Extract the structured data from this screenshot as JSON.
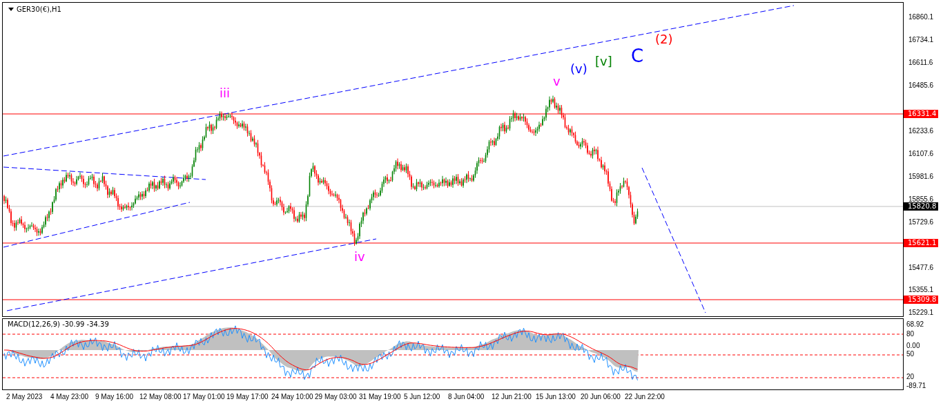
{
  "chart": {
    "title": "GER30(€),H1"
  },
  "wave_labels": [
    {
      "text": "iii",
      "color": "#ff00ff"
    },
    {
      "text": "iv",
      "color": "#ff00ff"
    },
    {
      "text": "v",
      "color": "#ff00ff"
    },
    {
      "text": "(v)",
      "color": "#0000ff"
    },
    {
      "text": "[v]",
      "color": "#008000"
    },
    {
      "text": "C",
      "color": "#0000ff"
    },
    {
      "text": "(2)",
      "color": "#ff0000"
    }
  ],
  "price_axis": [
    {
      "kind": "tick",
      "text": "16860.1"
    },
    {
      "kind": "tick",
      "text": "16734.1"
    },
    {
      "kind": "tick",
      "text": "16611.6"
    },
    {
      "kind": "tick",
      "text": "16485.6"
    },
    {
      "kind": "tag",
      "text": "16331.4",
      "color": "#ff0000"
    },
    {
      "kind": "tick",
      "text": "16233.6"
    },
    {
      "kind": "tick",
      "text": "16107.6"
    },
    {
      "kind": "tick",
      "text": "15981.6"
    },
    {
      "kind": "tick",
      "text": "15855.6"
    },
    {
      "kind": "tag",
      "text": "15820.8",
      "color": "#000000"
    },
    {
      "kind": "tick",
      "text": "15729.6"
    },
    {
      "kind": "tag",
      "text": "15621.1",
      "color": "#ff0000"
    },
    {
      "kind": "tick",
      "text": "15477.6"
    },
    {
      "kind": "tick",
      "text": "15355.1"
    },
    {
      "kind": "tag",
      "text": "15309.8",
      "color": "#ff0000"
    },
    {
      "kind": "tick",
      "text": "15229.1"
    }
  ],
  "indicator": {
    "title": "MACD(12,26,9) -30.99 -34.39",
    "axis": [
      "68.92",
      "80",
      "0.00",
      "50",
      "20",
      "-89.71"
    ]
  },
  "time_axis": [
    "2 May 2023",
    "4 May 23:00",
    "9 May 16:00",
    "12 May 08:00",
    "17 May 01:00",
    "19 May 17:00",
    "24 May 10:00",
    "29 May 03:00",
    "31 May 19:00",
    "5 Jun 12:00",
    "8 Jun 04:00",
    "12 Jun 21:00",
    "15 Jun 13:00",
    "20 Jun 06:00",
    "22 Jun 22:00"
  ]
}
